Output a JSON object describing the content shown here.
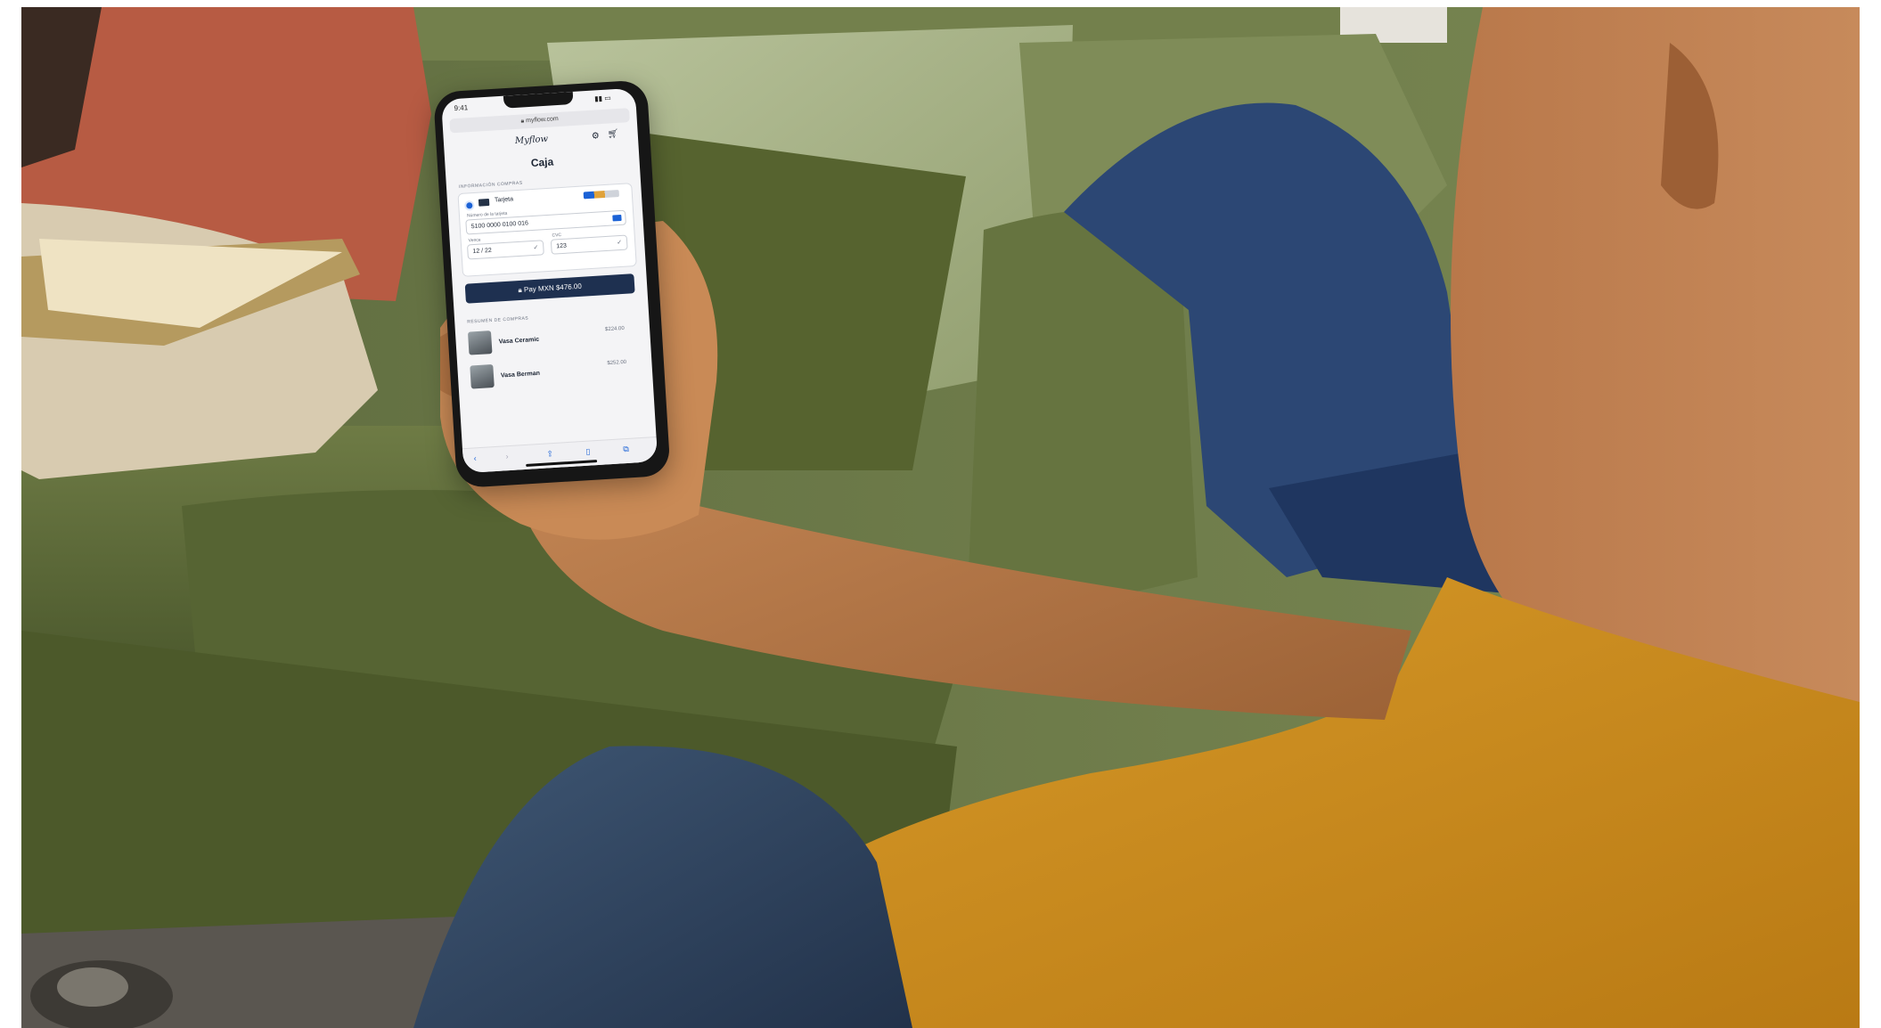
{
  "phone": {
    "status_time": "9:41",
    "url": "myflow.com",
    "store_logo": "Myflow",
    "page_title": "Caja",
    "payment_section_label": "Información compras",
    "payment_method": "Tarjeta",
    "card_number_label": "Número de la tarjeta",
    "card_number": "5100 0000 0100 016",
    "expiry_label": "Vence",
    "expiry_value": "12 / 22",
    "cvc_label": "CVC",
    "cvc_value": "123",
    "pay_button": "Pay MXN $476.00",
    "summary_label": "Resumen de compras",
    "items": [
      {
        "name": "Vasa Ceramic",
        "price": "$224.00"
      },
      {
        "name": "Vasa Berman",
        "price": "$252.00"
      }
    ]
  }
}
